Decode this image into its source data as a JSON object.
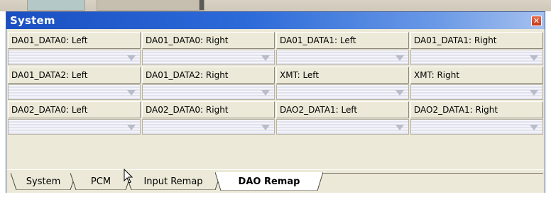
{
  "window": {
    "title": "System",
    "close_glyph": "✕"
  },
  "combo_icon": "chevron-down-icon",
  "rows": [
    {
      "cells": [
        {
          "label": "DA01_DATA0: Left",
          "value": ""
        },
        {
          "label": "DA01_DATA0: Right",
          "value": ""
        },
        {
          "label": "DA01_DATA1: Left",
          "value": ""
        },
        {
          "label": "DA01_DATA1: Right",
          "value": ""
        }
      ]
    },
    {
      "cells": [
        {
          "label": "DA01_DATA2: Left",
          "value": ""
        },
        {
          "label": "DA01_DATA2: Right",
          "value": ""
        },
        {
          "label": "XMT: Left",
          "value": ""
        },
        {
          "label": "XMT: Right",
          "value": ""
        }
      ]
    },
    {
      "cells": [
        {
          "label": "DA02_DATA0: Left",
          "value": ""
        },
        {
          "label": "DA02_DATA0: Right",
          "value": ""
        },
        {
          "label": "DAO2_DATA1: Left",
          "value": ""
        },
        {
          "label": "DAO2_DATA1: Right",
          "value": ""
        }
      ]
    }
  ],
  "tabs": [
    {
      "label": "System",
      "active": false
    },
    {
      "label": "PCM",
      "active": false
    },
    {
      "label": "Input Remap",
      "active": false
    },
    {
      "label": "DAO Remap",
      "active": true
    }
  ],
  "colors": {
    "titlebar_start": "#1a4fc2",
    "titlebar_end": "#a6c1ef",
    "panel_bg": "#ece9d8",
    "close_button": "#c4391b"
  }
}
